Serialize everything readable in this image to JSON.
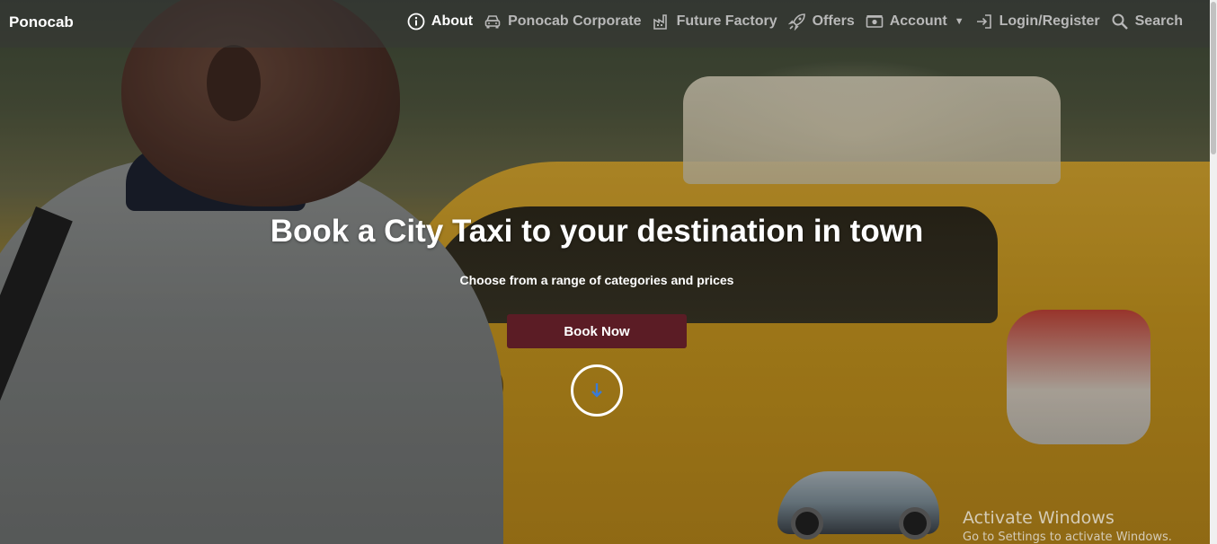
{
  "brand": {
    "name": "Ponocab"
  },
  "nav": {
    "items": [
      {
        "label": "About",
        "icon": "info-circle-icon",
        "active": true
      },
      {
        "label": "Ponocab Corporate",
        "icon": "car-icon",
        "active": false
      },
      {
        "label": "Future Factory",
        "icon": "factory-icon",
        "active": false
      },
      {
        "label": "Offers",
        "icon": "rocket-icon",
        "active": false
      },
      {
        "label": "Account",
        "icon": "money-icon",
        "active": false,
        "dropdown": true
      },
      {
        "label": "Login/Register",
        "icon": "sign-in-icon",
        "active": false
      },
      {
        "label": "Search",
        "icon": "search-icon",
        "active": false
      }
    ]
  },
  "hero": {
    "title": "Book a City Taxi to your destination in town",
    "subtitle": "Choose from a range of categories and prices",
    "button_label": "Book Now",
    "scroll_icon": "arrow-down-icon"
  },
  "watermark": {
    "title": "Activate Windows",
    "subtitle": "Go to Settings to activate Windows."
  },
  "colors": {
    "button_bg": "#5b1c25",
    "nav_active": "#ffffff",
    "nav_inactive": "#b8b8b8",
    "arrow": "#3a7bd5"
  }
}
